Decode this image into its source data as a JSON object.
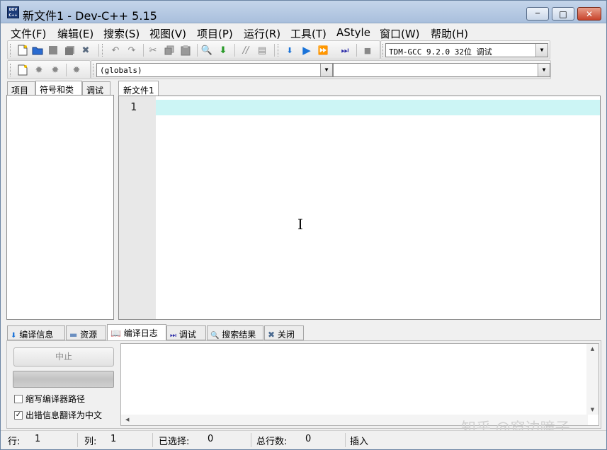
{
  "window": {
    "title": "新文件1 - Dev-C++ 5.15",
    "icon_text": "DEV C++",
    "min_label": "─",
    "max_label": "□",
    "close_label": "✕"
  },
  "menu": [
    "文件(F)",
    "编辑(E)",
    "搜索(S)",
    "视图(V)",
    "项目(P)",
    "运行(R)",
    "工具(T)",
    "AStyle",
    "窗口(W)",
    "帮助(H)"
  ],
  "toolbar": {
    "compiler_select": "TDM-GCC 9.2.0 32位 调试",
    "scope_select": "(globals)",
    "member_select": ""
  },
  "left_tabs": [
    "项目",
    "符号和类",
    "调试"
  ],
  "left_active_tab": 1,
  "editor": {
    "tab_label": "新文件1",
    "line_number": "1"
  },
  "bottom_tabs": [
    {
      "label": "编译信息",
      "icon": "compile-icon"
    },
    {
      "label": "资源",
      "icon": "folder-icon"
    },
    {
      "label": "编译日志",
      "icon": "book-icon"
    },
    {
      "label": "调试",
      "icon": "debug-icon"
    },
    {
      "label": "搜索结果",
      "icon": "magnifier-icon"
    },
    {
      "label": "关闭",
      "icon": "close-icon"
    }
  ],
  "bottom_active_tab": 2,
  "compile_panel": {
    "stop_label": "中止",
    "shorten_paths_label": "缩写编译器路径",
    "shorten_paths_checked": false,
    "translate_label": "出错信息翻译为中文",
    "translate_checked": true
  },
  "status": {
    "row_label": "行:",
    "row_value": "1",
    "col_label": "列:",
    "col_value": "1",
    "sel_label": "已选择:",
    "sel_value": "0",
    "total_label": "总行数:",
    "total_value": "0",
    "mode": "插入"
  },
  "watermark": "知乎 @窗边瞳子",
  "colors": {
    "current_line": "#ccf5f5",
    "titlebar": "#b4c8e2",
    "run_blue": "#1a73d9"
  }
}
